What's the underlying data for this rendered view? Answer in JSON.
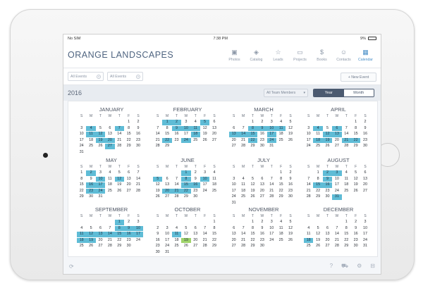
{
  "status": {
    "carrier": "No SIM",
    "wifi_icon": "wifi-icon",
    "time": "7:38 PM",
    "battery": "9%"
  },
  "app": {
    "title": "ORANGE LANDSCAPES"
  },
  "nav": [
    {
      "label": "Photos",
      "icon": "camera-icon",
      "glyph": "▣"
    },
    {
      "label": "Catalog",
      "icon": "layers-icon",
      "glyph": "◈"
    },
    {
      "label": "Leads",
      "icon": "star-icon",
      "glyph": "☆"
    },
    {
      "label": "Projects",
      "icon": "folder-icon",
      "glyph": "▭"
    },
    {
      "label": "Books",
      "icon": "dollar-icon",
      "glyph": "$"
    },
    {
      "label": "Contacts",
      "icon": "people-icon",
      "glyph": "☺"
    },
    {
      "label": "Calendar",
      "icon": "calendar-icon",
      "glyph": "▦"
    }
  ],
  "filters": {
    "filter1": "All Events",
    "filter2": "All Events",
    "new_event": "+ New Event"
  },
  "view": {
    "year": "2016",
    "team": "All Team Members",
    "year_tab": "Year",
    "month_tab": "Month"
  },
  "weekdays": [
    "S",
    "M",
    "T",
    "W",
    "T",
    "F",
    "S"
  ],
  "months": [
    {
      "name": "JANUARY",
      "offset": 5,
      "days": 31,
      "hl": [
        4,
        7,
        11,
        12,
        19,
        20,
        27
      ]
    },
    {
      "name": "FEBRUARY",
      "offset": 1,
      "days": 29,
      "hl": [
        1,
        2,
        5,
        9,
        10,
        11,
        18,
        22,
        24
      ]
    },
    {
      "name": "MARCH",
      "offset": 2,
      "days": 31,
      "hl": [
        8,
        9,
        10,
        11,
        13,
        14,
        15,
        17,
        22,
        24
      ]
    },
    {
      "name": "APRIL",
      "offset": 5,
      "days": 30,
      "hl": [
        4,
        6,
        12,
        13,
        18,
        19,
        21,
        22
      ]
    },
    {
      "name": "MAY",
      "offset": 0,
      "days": 31,
      "hl": [
        2,
        10,
        12,
        16,
        17,
        23,
        24
      ]
    },
    {
      "name": "JUNE",
      "offset": 3,
      "days": 30,
      "hl": [
        1,
        5,
        8,
        10,
        15,
        16,
        20,
        21,
        22
      ]
    },
    {
      "name": "JULY",
      "offset": 5,
      "days": 31,
      "hl": []
    },
    {
      "name": "AUGUST",
      "offset": 1,
      "days": 31,
      "hl": [
        2,
        3,
        9,
        15,
        16,
        31
      ]
    },
    {
      "name": "SEPTEMBER",
      "offset": 4,
      "days": 30,
      "hl": [
        1,
        8,
        9,
        10,
        11,
        12,
        13,
        14,
        15,
        16,
        17,
        18,
        19
      ]
    },
    {
      "name": "OCTOBER",
      "offset": 6,
      "days": 31,
      "hl": [
        11
      ]
    },
    {
      "name": "NOVEMBER",
      "offset": 2,
      "days": 30,
      "hl": []
    },
    {
      "name": "DECEMBER",
      "offset": 4,
      "days": 31,
      "hl": [
        18
      ]
    }
  ],
  "today": {
    "month": 9,
    "day": 19
  },
  "footer": {
    "refresh_icon": "refresh-icon",
    "help_icon": "help-icon",
    "cart_icon": "cart-icon",
    "settings_icon": "gear-icon",
    "lock_icon": "lock-icon"
  },
  "colors": {
    "highlight": "#5fbcd6",
    "today": "#9fd36a",
    "brand": "#4f6480",
    "accent": "#4a90c8"
  }
}
